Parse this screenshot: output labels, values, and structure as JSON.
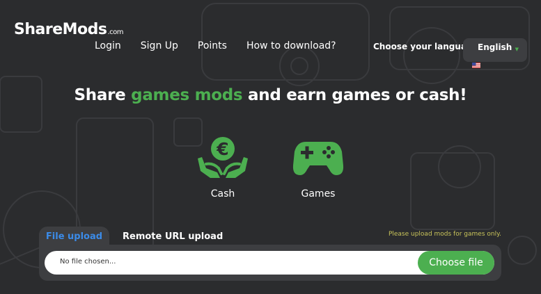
{
  "brand": {
    "name": "ShareMods",
    "domain": ".com"
  },
  "nav": {
    "items": [
      {
        "label": "Login"
      },
      {
        "label": "Sign Up"
      },
      {
        "label": "Points"
      },
      {
        "label": "How to download?"
      }
    ]
  },
  "language": {
    "label": "Choose your language:",
    "selected": "English",
    "flag_icon": "us-flag-icon"
  },
  "hero": {
    "headline_before": "Share ",
    "headline_highlight": "games mods",
    "headline_after": " and earn games or cash!"
  },
  "options": [
    {
      "label": "Cash",
      "icon": "euro-hands-icon"
    },
    {
      "label": "Games",
      "icon": "gamepad-icon"
    }
  ],
  "upload": {
    "tabs": [
      {
        "label": "File upload",
        "active": true
      },
      {
        "label": "Remote URL upload",
        "active": false
      }
    ],
    "notice": "Please upload mods for games only.",
    "file_status": "No file chosen...",
    "choose_label": "Choose file"
  },
  "colors": {
    "background": "#2b2c2e",
    "panel": "#3d3e41",
    "accent_green": "#4caf50",
    "active_tab_blue": "#3b8be8",
    "notice_yellow": "#c8c35a"
  }
}
